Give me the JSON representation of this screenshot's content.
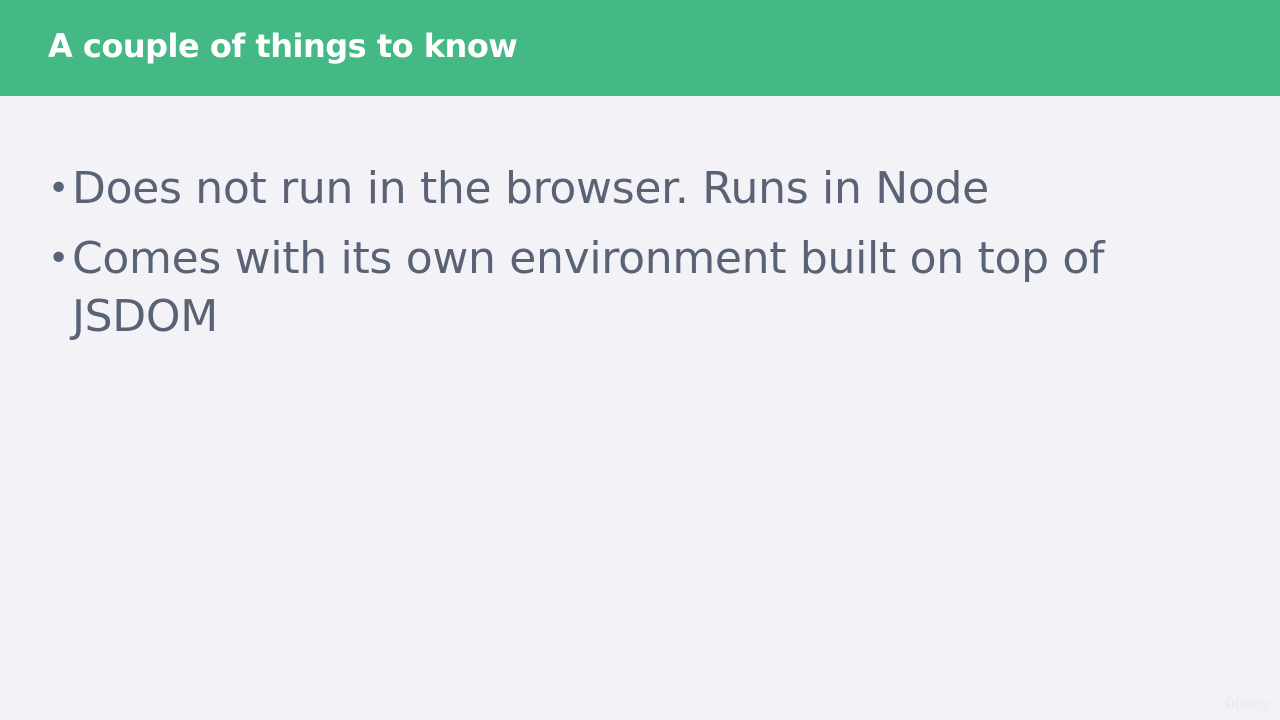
{
  "slide": {
    "title": "A couple of things to know",
    "bullets": [
      {
        "text": "Does not run in the browser. Runs in Node"
      },
      {
        "text": "Comes with its own environment built on top of JSDOM"
      }
    ],
    "watermark": "ûdemy"
  },
  "colors": {
    "header_bg": "#45b985",
    "slide_bg": "#f3f2f7",
    "title_text": "#ffffff",
    "body_text": "#5a6275"
  }
}
